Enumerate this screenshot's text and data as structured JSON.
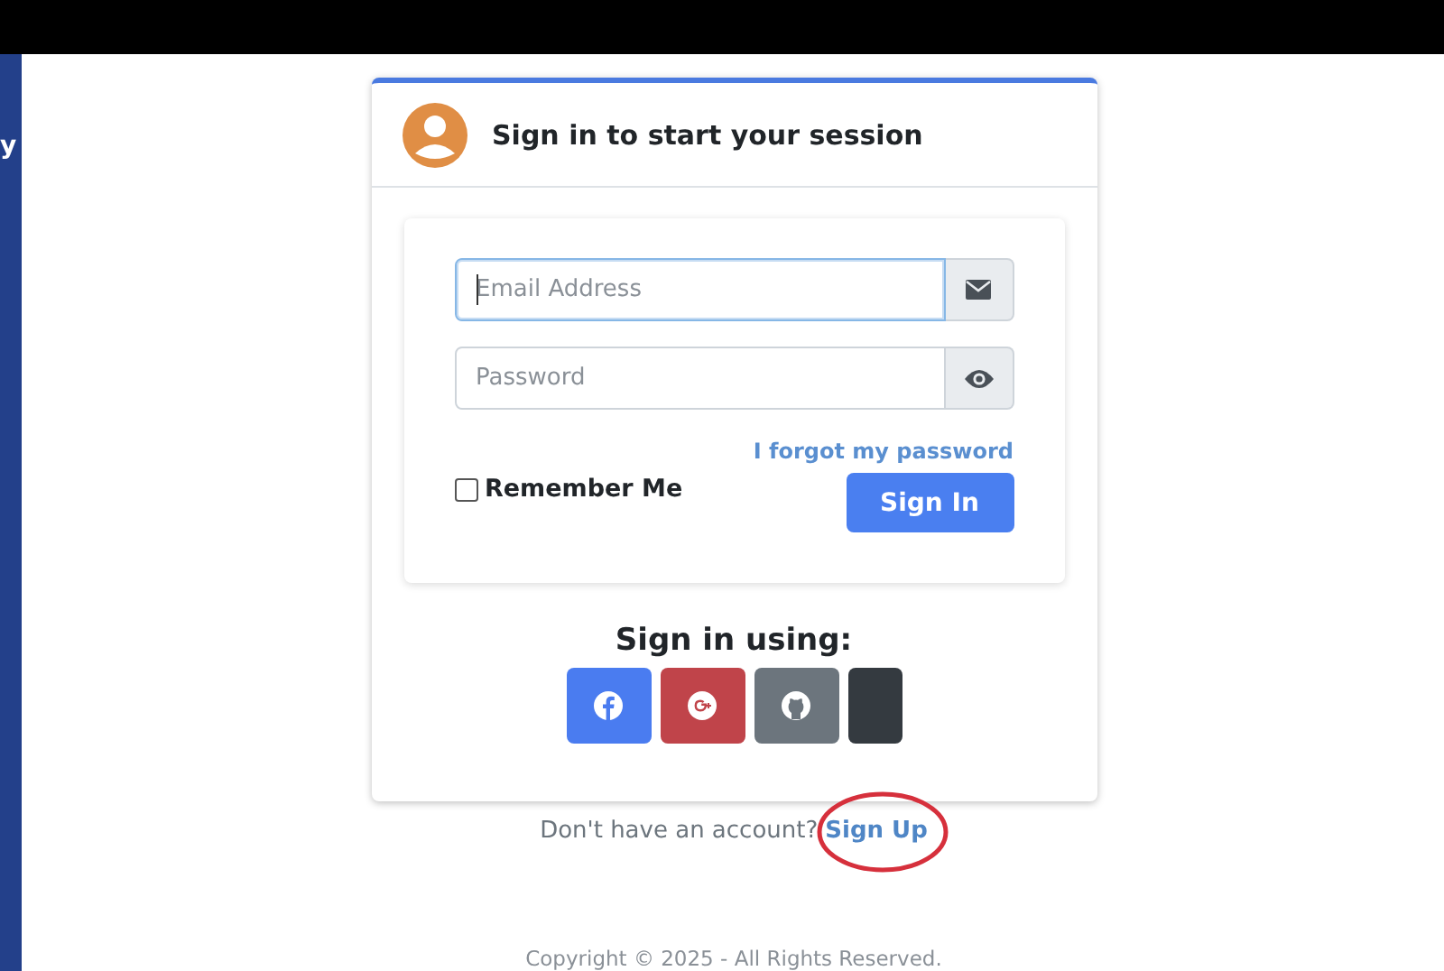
{
  "side_panel": {
    "text": "y"
  },
  "card": {
    "title": "Sign in to start your session"
  },
  "fields": [
    {
      "kind": "email",
      "placeholder": "Email Address",
      "focused": true
    },
    {
      "kind": "password",
      "placeholder": "Password",
      "focused": false
    }
  ],
  "forgot_link": "I forgot my password",
  "remember": {
    "label": "Remember Me",
    "checked": false
  },
  "submit_button": "Sign In",
  "social": {
    "heading": "Sign in using:",
    "buttons": [
      {
        "kind": "facebook"
      },
      {
        "kind": "google"
      },
      {
        "kind": "github"
      },
      {
        "kind": "blank"
      }
    ]
  },
  "signup": {
    "text": "Don't have an account?",
    "link": "Sign Up"
  },
  "annotations": [
    {
      "kind": "ellipse"
    }
  ],
  "footer": "Copyright © 2025 - All Rights Reserved."
}
